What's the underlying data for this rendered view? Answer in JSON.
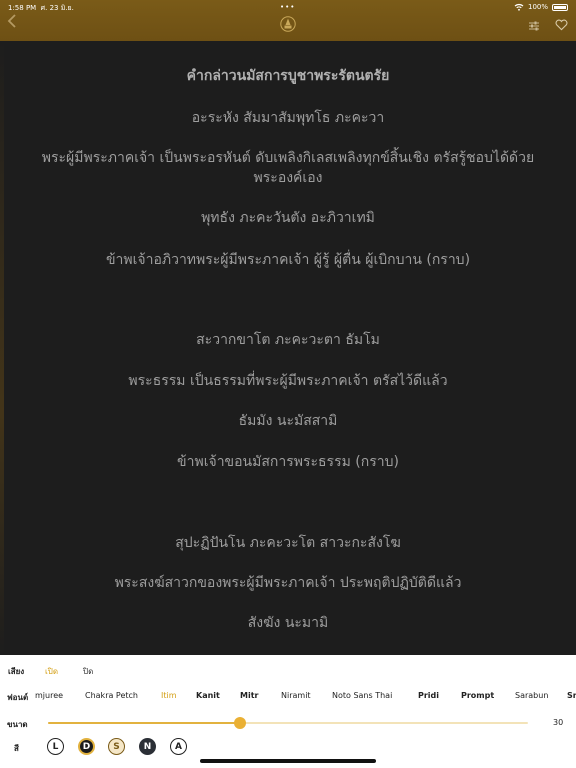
{
  "status": {
    "time": "1:58 PM",
    "date": "ศ. 23 มิ.ย.",
    "battery": "100%"
  },
  "icons": {
    "back": "chevron-left-icon",
    "emblem": "temple-emblem-icon",
    "settings": "sliders-icon",
    "favorite": "heart-icon"
  },
  "content": {
    "lines": [
      {
        "text": "คำกล่าวนมัสการบูชาพระรัตนตรัย",
        "title": true
      },
      {
        "text": "อะระหัง สัมมาสัมพุทโธ ภะคะวา"
      },
      {
        "text": "พระผู้มีพระภาคเจ้า เป็นพระอรหันต์ ดับเพลิงกิเลสเพลิงทุกข์สิ้นเชิง ตรัสรู้ชอบได้ด้วย"
      },
      {
        "text": "พระองค์เอง"
      },
      {
        "text": "พุทธัง ภะคะวันตัง อะภิวาเทมิ"
      },
      {
        "text": "ข้าพเจ้าอภิวาทพระผู้มีพระภาคเจ้า ผู้รู้ ผู้ตื่น ผู้เบิกบาน (กราบ)"
      },
      {
        "text": "สะวากขาโต ภะคะวะตา ธัมโม"
      },
      {
        "text": "พระธรรม เป็นธรรมที่พระผู้มีพระภาคเจ้า ตรัสไว้ดีแล้ว"
      },
      {
        "text": "ธัมมัง นะมัสสามิ"
      },
      {
        "text": "ข้าพเจ้าขอนมัสการพระธรรม (กราบ)"
      },
      {
        "text": "สุปะฏิปันโน ภะคะวะโต สาวะกะสังโฆ"
      },
      {
        "text": "พระสงฆ์สาวกของพระผู้มีพระภาคเจ้า ประพฤติปฏิบัติดีแล้ว"
      },
      {
        "text": "สังฆัง นะมามิ"
      }
    ]
  },
  "settings": {
    "sound_label": "เสียง",
    "sound_options": [
      {
        "label": "เปิด",
        "selected": true
      },
      {
        "label": "ปิด",
        "selected": false
      }
    ],
    "font_label": "ฟอนต์",
    "fonts": [
      {
        "label": "mjuree",
        "selected": false
      },
      {
        "label": "Chakra Petch",
        "selected": false
      },
      {
        "label": "Itim",
        "selected": true
      },
      {
        "label": "Kanit",
        "selected": false
      },
      {
        "label": "Mitr",
        "selected": false
      },
      {
        "label": "Niramit",
        "selected": false
      },
      {
        "label": "Noto Sans Thai",
        "selected": false
      },
      {
        "label": "Pridi",
        "selected": false
      },
      {
        "label": "Prompt",
        "selected": false
      },
      {
        "label": "Sarabun",
        "selected": false
      },
      {
        "label": "Sr",
        "selected": false
      }
    ],
    "size_label": "ขนาด",
    "size_value": "30",
    "size_fraction": 0.4,
    "color_label": "สี",
    "color_options": [
      {
        "label": "L",
        "bg": "#ffffff",
        "fg": "#222222",
        "border": "#222222",
        "selected": false
      },
      {
        "label": "D",
        "bg": "#1c1c1c",
        "fg": "#ffffff",
        "border": "#e2b23f",
        "selected": true
      },
      {
        "label": "S",
        "bg": "#f5e7c8",
        "fg": "#7a5b18",
        "border": "#7a5b18",
        "selected": false
      },
      {
        "label": "N",
        "bg": "#2b2f36",
        "fg": "#ffffff",
        "border": "#2b2f36",
        "selected": false
      },
      {
        "label": "A",
        "bg": "#ffffff",
        "fg": "#222222",
        "border": "#222222",
        "selected": false
      }
    ]
  },
  "colors": {
    "header": "#7a5b18",
    "accent": "#e2b23f",
    "reader_bg": "#1d1d1d",
    "reader_text": "#9e9e9e"
  }
}
